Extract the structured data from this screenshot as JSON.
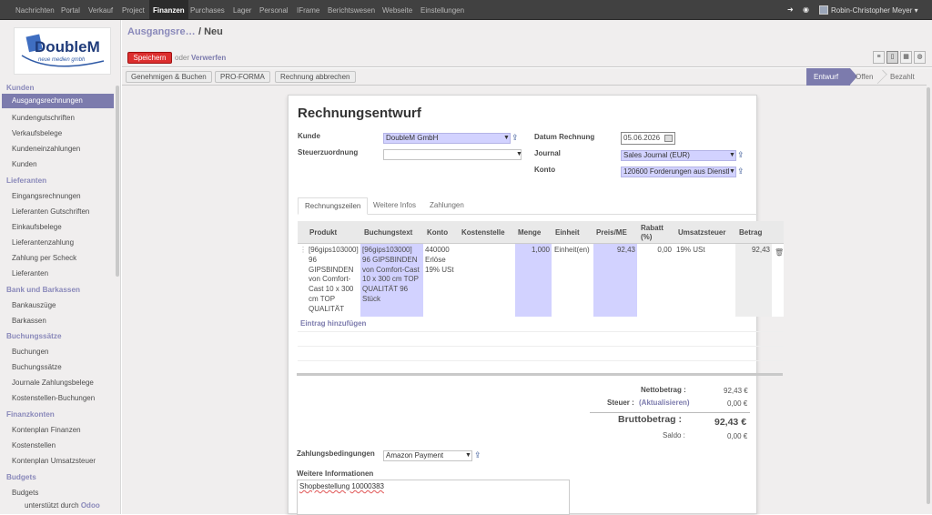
{
  "topbar": {
    "nav": [
      "Nachrichten",
      "Portal",
      "Verkauf",
      "Project",
      "Finanzen",
      "Purchases",
      "Lager",
      "Personal",
      "IFrame",
      "Berichtswesen",
      "Webseite",
      "Einstellungen"
    ],
    "active": "Finanzen",
    "user": "Robin-Christopher Meyer"
  },
  "logo": {
    "name": "DoubleM",
    "sub": "neue medien gmbh"
  },
  "sidebar": {
    "sections": [
      {
        "title": "Kunden",
        "items": [
          "Ausgangsrechnungen",
          "Kundengutschriften",
          "Verkaufsbelege",
          "Kundeneinzahlungen",
          "Kunden"
        ]
      },
      {
        "title": "Lieferanten",
        "items": [
          "Eingangsrechnungen",
          "Lieferanten Gutschriften",
          "Einkaufsbelege",
          "Lieferantenzahlung",
          "Zahlung per Scheck",
          "Lieferanten"
        ]
      },
      {
        "title": "Bank und Barkassen",
        "items": [
          "Bankauszüge",
          "Barkassen"
        ]
      },
      {
        "title": "Buchungssätze",
        "items": [
          "Buchungen",
          "Buchungssätze",
          "Journale Zahlungsbelege",
          "Kostenstellen-Buchungen"
        ]
      },
      {
        "title": "Finanzkonten",
        "items": [
          "Kontenplan Finanzen",
          "Kostenstellen",
          "Kontenplan Umsatzsteuer"
        ]
      },
      {
        "title": "Budgets",
        "items": [
          "Budgets"
        ]
      }
    ],
    "selected": "Ausgangsrechnungen",
    "footer_text": "unterstützt durch",
    "footer_brand": "Odoo"
  },
  "header": {
    "breadcrumb_parent": "Ausgangsre…",
    "breadcrumb_current": "/ Neu",
    "save_label": "Speichern",
    "or_label": "oder",
    "discard_label": "Verwerfen"
  },
  "actions": [
    "Genehmigen & Buchen",
    "PRO-FORMA",
    "Rechnung abbrechen"
  ],
  "statusbar": [
    "Entwurf",
    "Offen",
    "Bezahlt"
  ],
  "form": {
    "title": "Rechnungsentwurf",
    "kunde_label": "Kunde",
    "kunde_value": "DoubleM GmbH",
    "steuer_label": "Steuerzuordnung",
    "steuer_value": "",
    "datum_label": "Datum Rechnung",
    "datum_value": "05.06.2026",
    "journal_label": "Journal",
    "journal_value": "Sales Journal (EUR)",
    "konto_label": "Konto",
    "konto_value": "120600 Forderungen aus Dienstl"
  },
  "tabs": [
    "Rechnungszeilen",
    "Weitere Infos",
    "Zahlungen"
  ],
  "lines": {
    "headers": [
      "Produkt",
      "Buchungstext",
      "Konto",
      "Kostenstelle",
      "Menge",
      "Einheit",
      "Preis/ME",
      "Rabatt (%)",
      "Umsatzsteuer",
      "Betrag"
    ],
    "row": {
      "produkt": "[96gips103000] 96 GIPSBINDEN von Comfort-Cast 10 x 300 cm TOP QUALITÄT",
      "text": "[96gips103000] 96 GIPSBINDEN von Comfort-Cast 10 x 300 cm TOP QUALITÄT 96 Stück",
      "konto": "440000 Erlöse 19% USt",
      "kostenstelle": "",
      "menge": "1,000",
      "einheit": "Einheit(en)",
      "preis": "92,43",
      "rabatt": "0,00",
      "steuer": "19% USt",
      "betrag": "92,43"
    },
    "add_label": "Eintrag hinzufügen"
  },
  "totals": {
    "netto_label": "Nettobetrag :",
    "netto_value": "92,43 €",
    "steuer_label": "Steuer :",
    "steuer_link": "(Aktualisieren)",
    "steuer_value": "0,00 €",
    "brutto_label": "Bruttobetrag :",
    "brutto_value": "92,43 €",
    "saldo_label": "Saldo :",
    "saldo_value": "0,00 €"
  },
  "payment": {
    "label": "Zahlungsbedingungen",
    "value": "Amazon Payment"
  },
  "notes": {
    "label": "Weitere Informationen",
    "value": "Shopbestellung 10000383"
  }
}
